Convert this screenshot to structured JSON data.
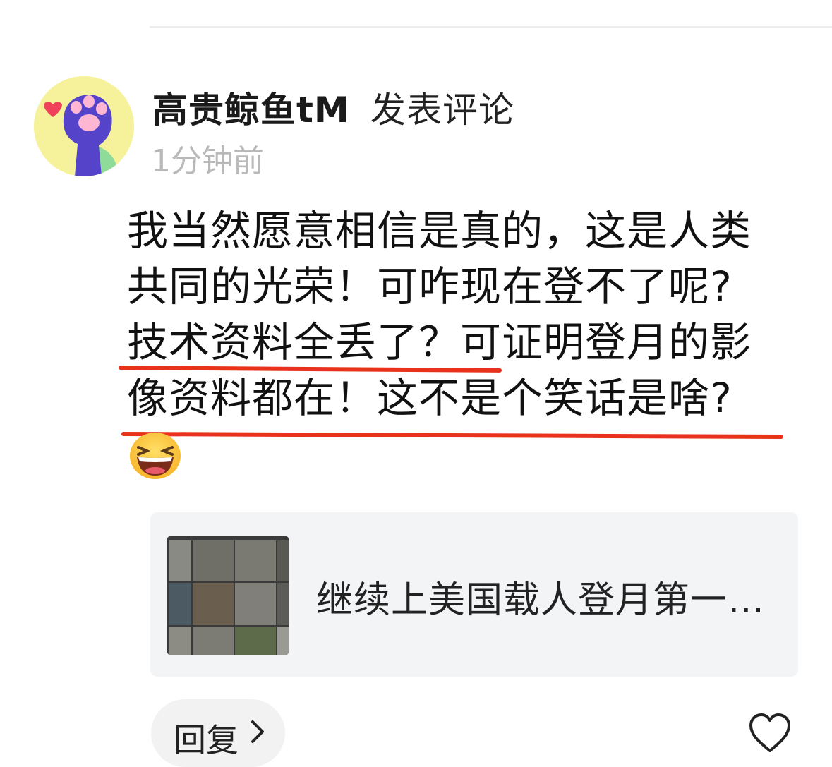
{
  "comment": {
    "username": "高贵鲸鱼tM",
    "action": "发表评论",
    "timestamp": "1分钟前",
    "text_lines": [
      "我当然愿意相信是真的，这是人类",
      "共同的光荣！可咋现在登不了呢?",
      "技术资料全丢了？可证明登月的影",
      "像资料都在！这不是个笑话是啥?"
    ],
    "emoji": "laughing-face-icon"
  },
  "link_card": {
    "title": "继续上美国载人登月第一…",
    "thumbnail": "moon-landing-photo-grid"
  },
  "actions": {
    "reply_label": "回复",
    "reply_icon": "chevron-right-icon",
    "like_icon": "heart-outline-icon"
  },
  "colors": {
    "underline": "#e8321c",
    "avatar_bg": "#f6f29b",
    "paw": "#5543c9",
    "timestamp": "#b9b9b9",
    "card_bg": "#f3f4f6"
  }
}
